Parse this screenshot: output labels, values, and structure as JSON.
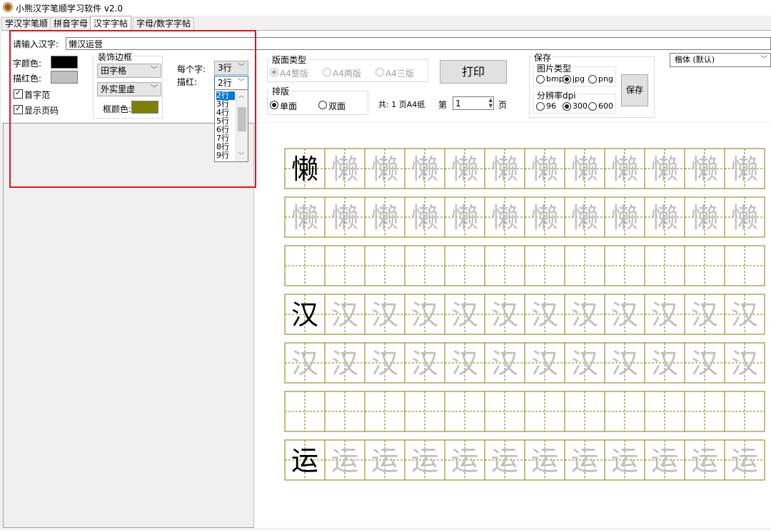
{
  "window": {
    "title": "小熊汉字笔顺学习软件 v2.0"
  },
  "tabs": [
    {
      "label": "学汉字笔顺"
    },
    {
      "label": "拼音字母"
    },
    {
      "label": "汉字字帖"
    },
    {
      "label": "字母/数字字帖"
    }
  ],
  "input": {
    "label": "请输入汉字:",
    "value": "懒汉运营"
  },
  "colors": {
    "char_color_label": "字颜色:",
    "char_color": "#000000",
    "trace_color_label": "描红色:",
    "trace_color": "#c0c0c0",
    "frame_color_label": "框颜色:",
    "frame_color": "#808000"
  },
  "options": {
    "first_char_model": "首字范",
    "show_page_number": "显示页码"
  },
  "decoration": {
    "title": "装饰边框",
    "grid_style": "田字格",
    "border_style": "外实里虚"
  },
  "rows": {
    "per_char_label": "每个字:",
    "per_char_value": "3行",
    "trace_label": "描红:",
    "trace_value": "2行",
    "trace_options": [
      "2行",
      "3行",
      "4行",
      "5行",
      "6行",
      "7行",
      "8行",
      "9行"
    ]
  },
  "layout_type": {
    "title": "版面类型",
    "options": [
      "A4整版",
      "A4两版",
      "A4三版"
    ]
  },
  "print_button": "打印",
  "imposition": {
    "title": "排版",
    "options": [
      "单面",
      "双面"
    ]
  },
  "pages": {
    "total_text": "共: 1 页A4纸",
    "prefix": "第",
    "value": "1",
    "suffix": "页"
  },
  "save": {
    "title": "保存",
    "image_type_title": "图片类型",
    "image_types": [
      "bmp",
      "jpg",
      "png"
    ],
    "dpi_title": "分辨率dpi",
    "dpis": [
      "96",
      "300",
      "600"
    ],
    "button": "保存"
  },
  "font_select": {
    "value": "楷体 (默认)"
  },
  "worksheet": {
    "characters": [
      "懒",
      "汉",
      "运"
    ],
    "columns": 12
  }
}
